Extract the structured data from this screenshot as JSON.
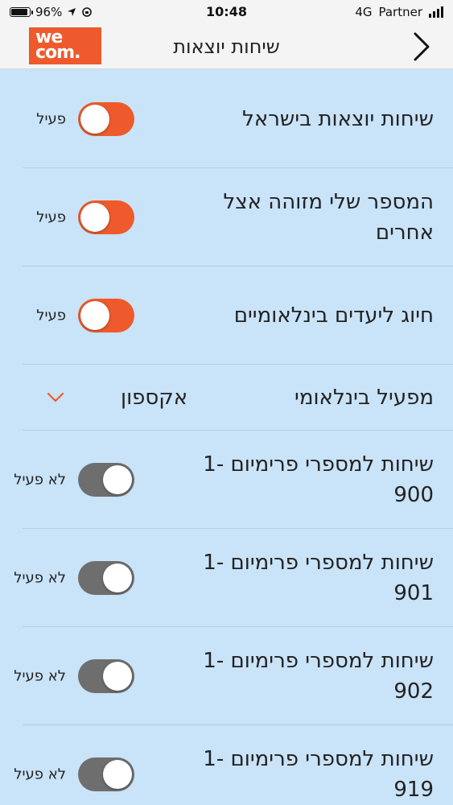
{
  "status_bar": {
    "battery": "96%",
    "time": "10:48",
    "network": "4G",
    "carrier": "Partner"
  },
  "header": {
    "logo_line1": "we",
    "logo_line2": "com.",
    "title": "שיחות יוצאות"
  },
  "rows": [
    {
      "label": "שיחות יוצאות בישראל",
      "state": "פעיל",
      "on": true
    },
    {
      "label": "המספר שלי מזוהה אצל אחרים",
      "state": "פעיל",
      "on": true
    },
    {
      "label": "חיוג ליעדים בינלאומיים",
      "state": "פעיל",
      "on": true
    },
    {
      "label": "שיחות למספרי פרימיום 1-900",
      "state": "לא פעיל",
      "on": false
    },
    {
      "label": "שיחות למספרי פרימיום 1-901",
      "state": "לא פעיל",
      "on": false
    },
    {
      "label": "שיחות למספרי פרימיום 1-902",
      "state": "לא פעיל",
      "on": false
    },
    {
      "label": "שיחות למספרי פרימיום 1-919",
      "state": "לא פעיל",
      "on": false
    }
  ],
  "operator": {
    "label": "מפעיל בינלאומי",
    "value": "אקספון"
  },
  "colors": {
    "accent": "#ee5a2c",
    "toggle_off": "#6e6e6e",
    "background": "#c9e3f8"
  }
}
